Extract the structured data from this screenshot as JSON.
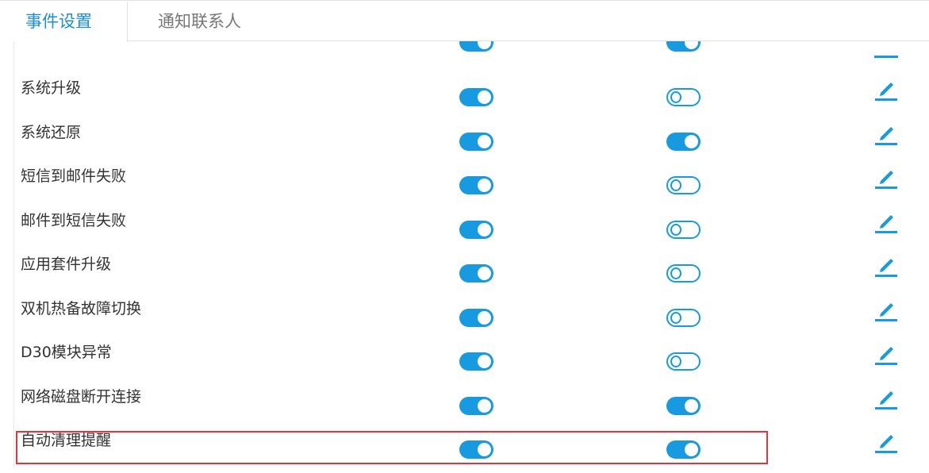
{
  "tabs": [
    {
      "label": "事件设置",
      "active": true
    },
    {
      "label": "通知联系人",
      "active": false
    }
  ],
  "partial_row": {
    "toggle1": true,
    "toggle2": true
  },
  "events": [
    {
      "name": "系统升级",
      "toggle1": true,
      "toggle2": false
    },
    {
      "name": "系统还原",
      "toggle1": true,
      "toggle2": true
    },
    {
      "name": "短信到邮件失败",
      "toggle1": true,
      "toggle2": false
    },
    {
      "name": "邮件到短信失败",
      "toggle1": true,
      "toggle2": false
    },
    {
      "name": "应用套件升级",
      "toggle1": true,
      "toggle2": false
    },
    {
      "name": "双机热备故障切换",
      "toggle1": true,
      "toggle2": false
    },
    {
      "name": "D30模块异常",
      "toggle1": true,
      "toggle2": false
    },
    {
      "name": "网络磁盘断开连接",
      "toggle1": true,
      "toggle2": true
    },
    {
      "name": "自动清理提醒",
      "toggle1": true,
      "toggle2": true,
      "highlighted": true
    }
  ],
  "colors": {
    "accent": "#179ae0",
    "highlight": "#e1373c"
  },
  "icons": {
    "edit": "pencil-edit-icon"
  }
}
